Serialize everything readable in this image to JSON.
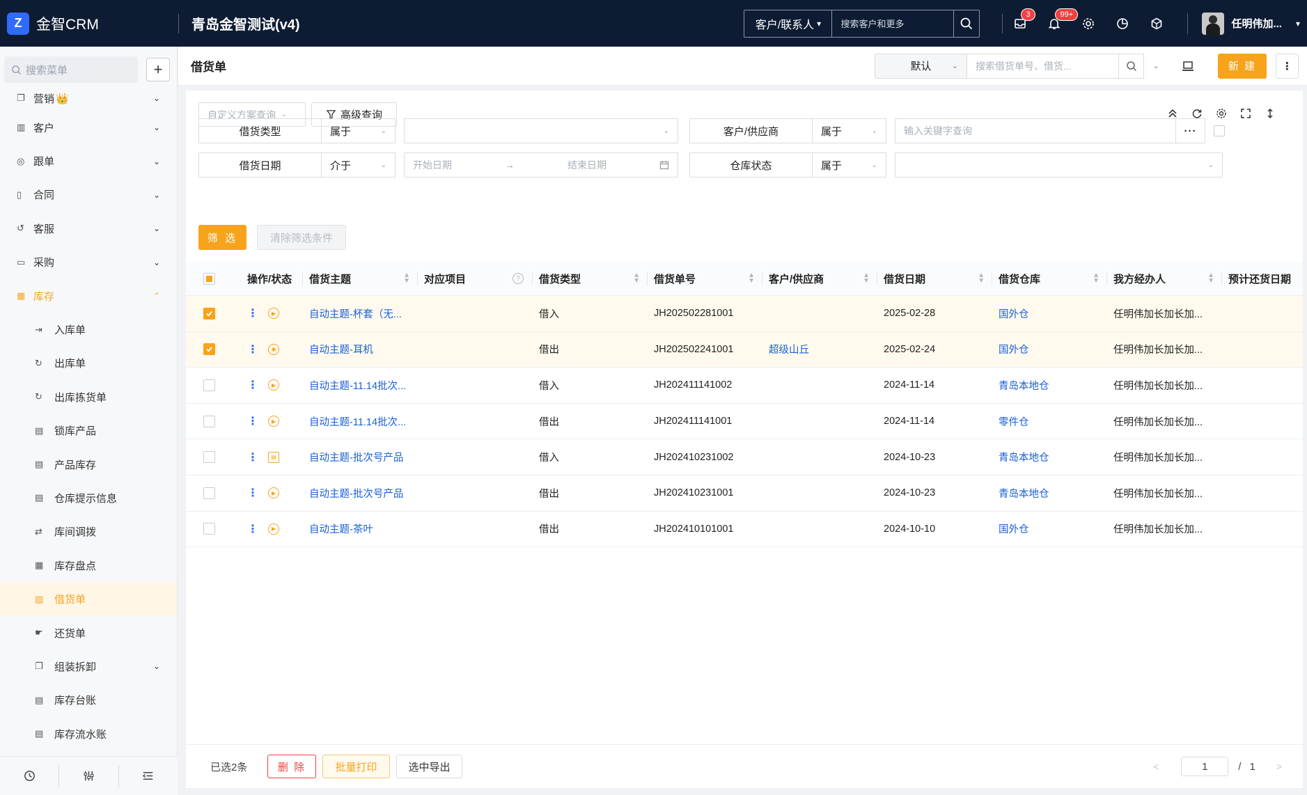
{
  "topbar": {
    "logo_text": "金智CRM",
    "company": "青岛金智测试(v4)",
    "search_scope": "客户/联系人",
    "search_placeholder": "搜索客户和更多",
    "message_badge": "3",
    "notice_badge": "99+",
    "user_name": "任明伟加..."
  },
  "sidebar": {
    "search_placeholder": "搜索菜单",
    "items": [
      {
        "label": "营销",
        "crown": "👑"
      },
      {
        "label": "客户"
      },
      {
        "label": "跟单"
      },
      {
        "label": "合同"
      },
      {
        "label": "客服"
      },
      {
        "label": "采购"
      },
      {
        "label": "库存"
      }
    ],
    "sub_items": [
      {
        "label": "入库单"
      },
      {
        "label": "出库单"
      },
      {
        "label": "出库拣货单"
      },
      {
        "label": "锁库产品"
      },
      {
        "label": "产品库存"
      },
      {
        "label": "仓库提示信息"
      },
      {
        "label": "库间调拨"
      },
      {
        "label": "库存盘点"
      },
      {
        "label": "借货单"
      },
      {
        "label": "还货单"
      },
      {
        "label": "组装拆卸"
      },
      {
        "label": "库存台账"
      },
      {
        "label": "库存流水账"
      }
    ]
  },
  "header": {
    "title": "借货单",
    "view": "默认",
    "search_placeholder": "搜索借货单号、借货...",
    "new_label": "新 建"
  },
  "filters": {
    "scheme_placeholder": "自定义方案查询",
    "advanced_label": "高级查询",
    "row1": {
      "field1": "借货类型",
      "op1": "属于",
      "field2": "客户/供应商",
      "op2": "属于",
      "keyword_placeholder": "输入关键字查询"
    },
    "row2": {
      "field1": "借货日期",
      "op1": "介于",
      "start_placeholder": "开始日期",
      "arrow": "→",
      "end_placeholder": "结束日期",
      "field2": "仓库状态",
      "op2": "属于"
    },
    "filter_label": "筛 选",
    "clear_label": "清除筛选条件"
  },
  "table": {
    "columns": [
      "操作/状态",
      "借货主题",
      "对应项目",
      "借货类型",
      "借货单号",
      "客户/供应商",
      "借货日期",
      "借货仓库",
      "我方经办人",
      "预计还货日期"
    ],
    "rows": [
      {
        "selected": true,
        "subject": "自动主题-杯套（无...",
        "project": "",
        "type": "借入",
        "no": "JH202502281001",
        "customer": "",
        "date": "2025-02-28",
        "warehouse": "国外仓",
        "agent": "任明伟加长加长加...",
        "due": ""
      },
      {
        "selected": true,
        "subject": "自动主题-耳机",
        "project": "",
        "type": "借出",
        "no": "JH202502241001",
        "customer": "超级山丘",
        "date": "2025-02-24",
        "warehouse": "国外仓",
        "agent": "任明伟加长加长加...",
        "due": ""
      },
      {
        "selected": false,
        "subject": "自动主题-11.14批次...",
        "project": "",
        "type": "借入",
        "no": "JH202411141002",
        "customer": "",
        "date": "2024-11-14",
        "warehouse": "青岛本地仓",
        "agent": "任明伟加长加长加...",
        "due": ""
      },
      {
        "selected": false,
        "subject": "自动主题-11.14批次...",
        "project": "",
        "type": "借出",
        "no": "JH202411141001",
        "customer": "",
        "date": "2024-11-14",
        "warehouse": "零件仓",
        "agent": "任明伟加长加长加...",
        "due": ""
      },
      {
        "selected": false,
        "subject": "自动主题-批次号产品",
        "project": "",
        "type": "借入",
        "no": "JH202410231002",
        "customer": "",
        "date": "2024-10-23",
        "warehouse": "青岛本地仓",
        "agent": "任明伟加长加长加...",
        "due": ""
      },
      {
        "selected": false,
        "subject": "自动主题-批次号产品",
        "project": "",
        "type": "借出",
        "no": "JH202410231001",
        "customer": "",
        "date": "2024-10-23",
        "warehouse": "青岛本地仓",
        "agent": "任明伟加长加长加...",
        "due": ""
      },
      {
        "selected": false,
        "subject": "自动主题-茶叶",
        "project": "",
        "type": "借出",
        "no": "JH202410101001",
        "customer": "",
        "date": "2024-10-10",
        "warehouse": "国外仓",
        "agent": "任明伟加长加长加...",
        "due": ""
      }
    ]
  },
  "footer": {
    "selected_text": "已选2条",
    "delete_label": "删 除",
    "print_label": "批量打印",
    "export_label": "选中导出",
    "page": "1",
    "separator": "/",
    "total_pages": "1"
  },
  "colors": {
    "accent": "#f7a31c",
    "link": "#1a5fd8",
    "topbar": "#0e1c33",
    "danger": "#f04040"
  }
}
